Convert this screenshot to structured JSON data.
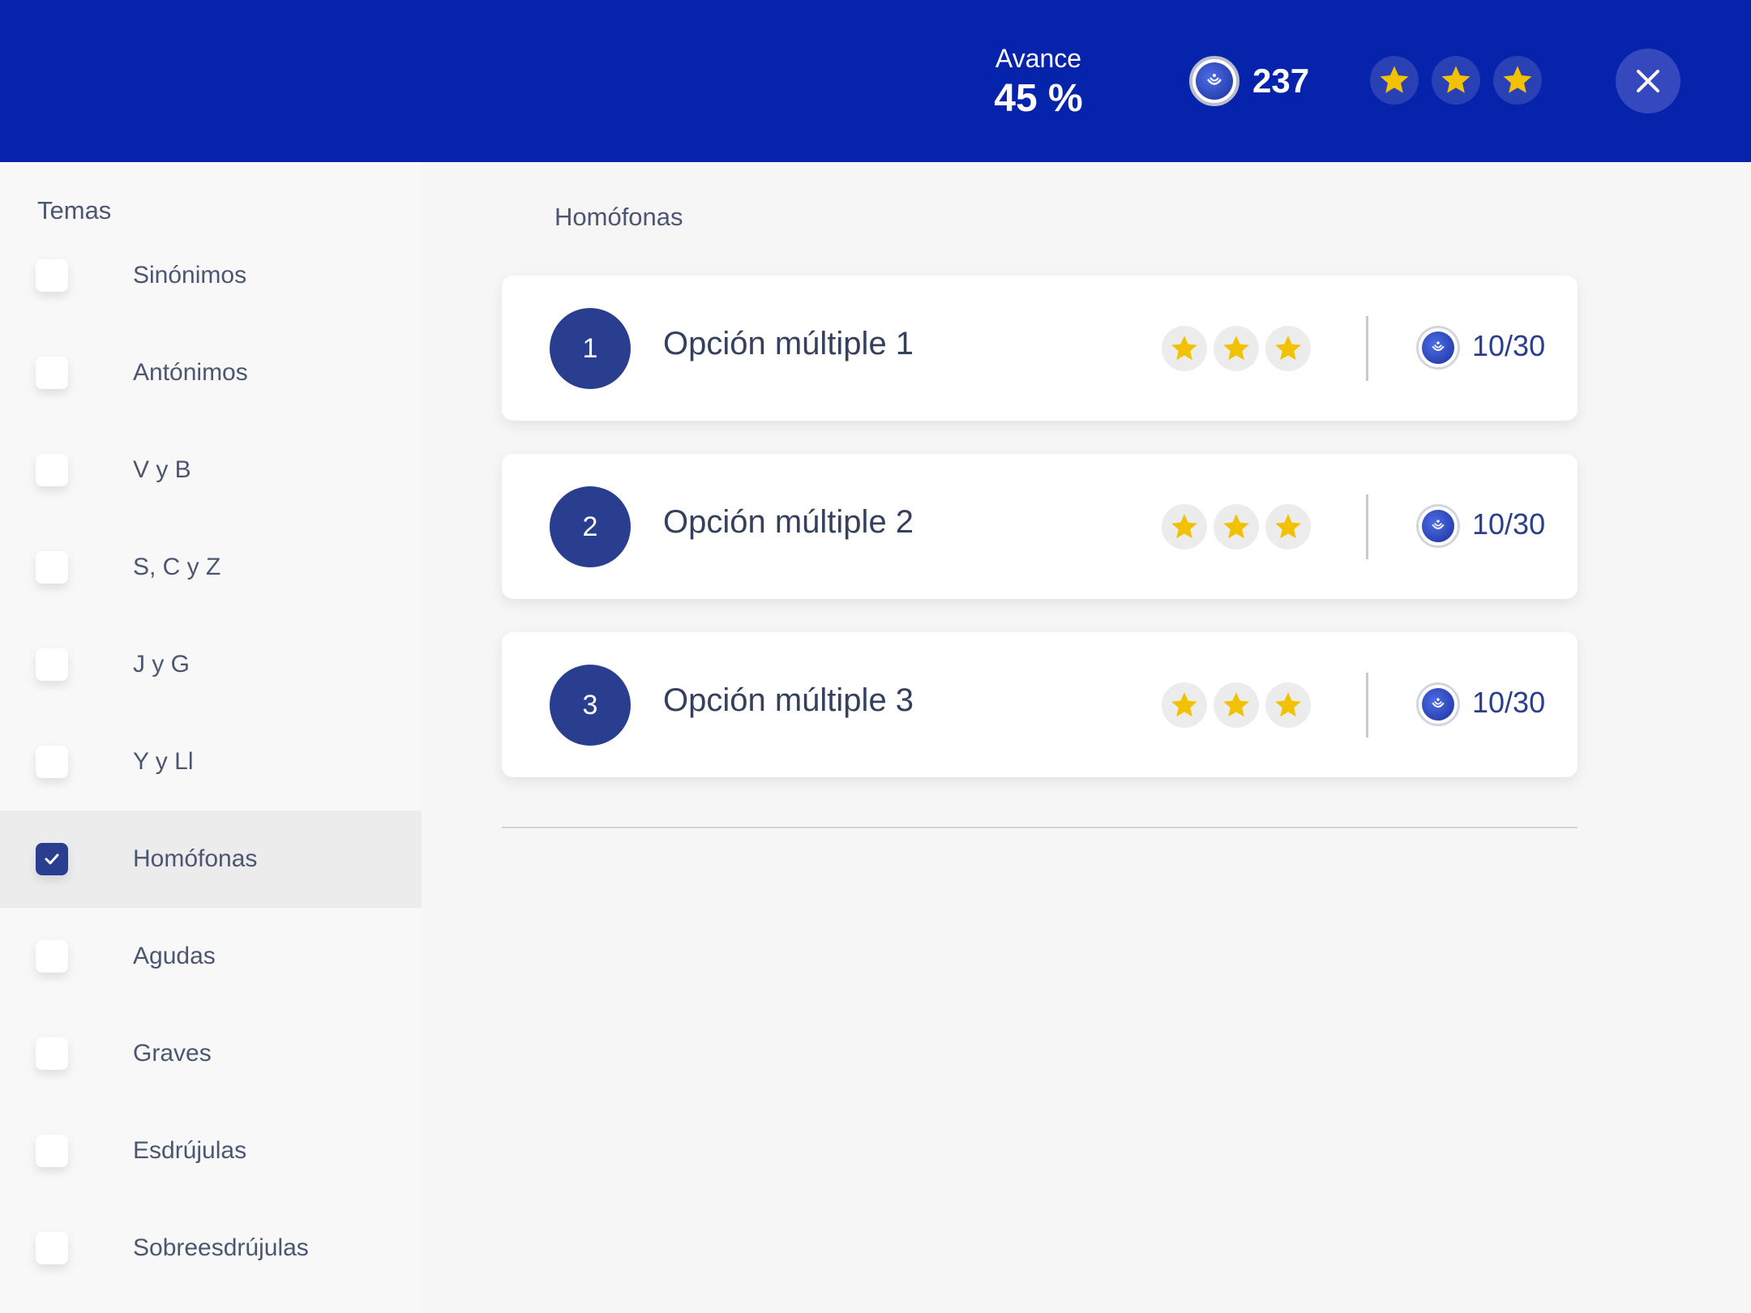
{
  "header": {
    "progress_label": "Avance",
    "progress_value": "45 %",
    "coins": "237",
    "stars_earned": 3,
    "bg_color": "#0623ab"
  },
  "sidebar": {
    "title": "Temas",
    "topics": [
      {
        "label": "Sinónimos",
        "checked": false
      },
      {
        "label": "Antónimos",
        "checked": false
      },
      {
        "label": "V y B",
        "checked": false
      },
      {
        "label": "S, C y Z",
        "checked": false
      },
      {
        "label": "J y G",
        "checked": false
      },
      {
        "label": "Y y Ll",
        "checked": false
      },
      {
        "label": "Homófonas",
        "checked": true
      },
      {
        "label": "Agudas",
        "checked": false
      },
      {
        "label": "Graves",
        "checked": false
      },
      {
        "label": "Esdrújulas",
        "checked": false
      },
      {
        "label": "Sobreesdrújulas",
        "checked": false
      }
    ]
  },
  "main": {
    "section_title": "Homófonas",
    "activities": [
      {
        "number": "1",
        "title": "Opción múltiple 1",
        "stars": 3,
        "score": "10/30"
      },
      {
        "number": "2",
        "title": "Opción múltiple 2",
        "stars": 3,
        "score": "10/30"
      },
      {
        "number": "3",
        "title": "Opción múltiple 3",
        "stars": 3,
        "score": "10/30"
      }
    ]
  },
  "icons": {
    "coin": "coin-icon",
    "star": "star-icon",
    "close": "close-icon",
    "check": "check-icon"
  },
  "colors": {
    "accent": "#2a3e8f",
    "star": "#f2c200"
  }
}
